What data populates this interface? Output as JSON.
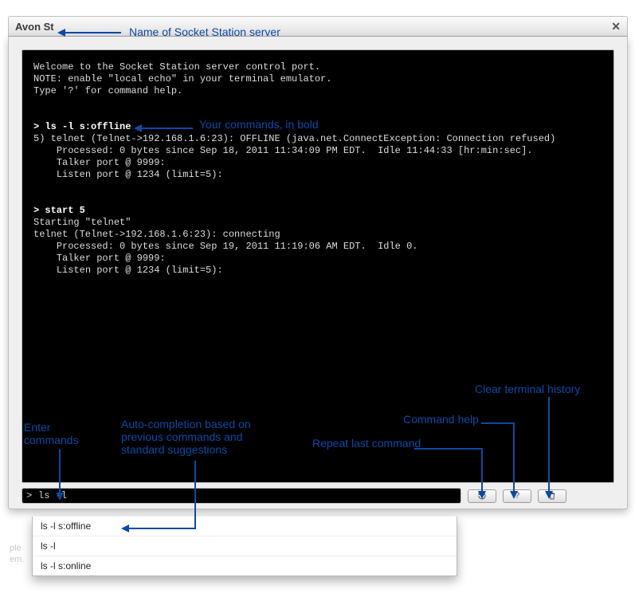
{
  "window": {
    "title": "Avon St",
    "close_glyph": "✕"
  },
  "terminal": {
    "welcome": [
      "Welcome to the Socket Station server control port.",
      "NOTE: enable \"local echo\" in your terminal emulator.",
      "Type '?' for command help."
    ],
    "blocks": [
      {
        "cmd": "> ls -l s:offline",
        "out": [
          "5) telnet (Telnet->192.168.1.6:23): OFFLINE (java.net.ConnectException: Connection refused)",
          "    Processed: 0 bytes since Sep 18, 2011 11:34:09 PM EDT.  Idle 11:44:33 [hr:min:sec].",
          "    Talker port @ 9999:",
          "    Listen port @ 1234 (limit=5):"
        ]
      },
      {
        "cmd": "> start 5",
        "out": [
          "Starting \"telnet\"",
          "telnet (Telnet->192.168.1.6:23): connecting",
          "    Processed: 0 bytes since Sep 19, 2011 11:19:06 AM EDT.  Idle 0.",
          "    Talker port @ 9999:",
          "    Listen port @ 1234 (limit=5):"
        ]
      }
    ]
  },
  "cmdline": {
    "prompt": ">",
    "value": "ls -l"
  },
  "autocomplete": {
    "items": [
      "ls -l s:offline",
      "ls -l",
      "ls -l s:online"
    ]
  },
  "buttons": {
    "refresh_name": "refresh-icon",
    "help_label": "?",
    "trash_name": "trash-icon"
  },
  "annotations": {
    "server_name": "Name of Socket Station server",
    "user_cmds": "Your commands, in bold",
    "enter_cmds": "Enter\ncommands",
    "auto": "Auto-completion based on\nprevious commands and\nstandard suggestions",
    "repeat": "Repeat last command",
    "help": "Command help",
    "clear": "Clear terminal history"
  },
  "background_hint": {
    "left": "ple",
    "right": "em."
  }
}
